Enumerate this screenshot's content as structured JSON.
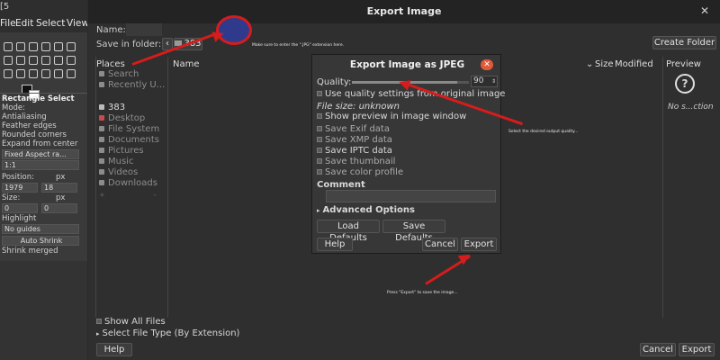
{
  "gimp": {
    "menu": [
      "File",
      "Edit",
      "Select",
      "View"
    ],
    "tool_title": "Rectangle Select",
    "mode_label": "Mode:",
    "options": [
      "Antialiasing",
      "Feather edges",
      "Rounded corners",
      "Expand from center"
    ],
    "fixed": "Fixed Aspect ra...",
    "ratio": "1:1",
    "position_label": "Position:",
    "position_unit": "px",
    "position_values": [
      "1979",
      "18"
    ],
    "size_label": "Size:",
    "size_unit": "px",
    "size_values": [
      "0",
      "0"
    ],
    "highlight": "Highlight",
    "guides": "No guides",
    "auto_shrink": "Auto Shrink",
    "shrink_merged": "Shrink merged"
  },
  "dialog": {
    "title": "Export Image",
    "name_label": "Name:",
    "save_in_label": "Save in folder:",
    "folder": "383",
    "create_folder": "Create Folder",
    "columns": {
      "places": "Places",
      "name": "Name",
      "size": "Size",
      "modified": "Modified",
      "preview": "Preview"
    },
    "places": [
      "Search",
      "Recently U...",
      "383",
      "Desktop",
      "File System",
      "Documents",
      "Pictures",
      "Music",
      "Videos",
      "Downloads"
    ],
    "preview_none": "No s...ction",
    "show_all": "Show All Files",
    "file_type": "Select File Type (By Extension)",
    "help": "Help",
    "cancel": "Cancel",
    "export": "Export"
  },
  "jpeg": {
    "title": "Export Image as JPEG",
    "quality_label": "Quality:",
    "quality_value": "90",
    "quality_fraction": 0.9,
    "use_quality": "Use quality settings from original image",
    "file_size": "File size: unknown",
    "show_preview": "Show preview in image window",
    "save_exif": "Save Exif data",
    "save_xmp": "Save XMP data",
    "save_iptc": "Save IPTC data",
    "save_thumb": "Save thumbnail",
    "save_color": "Save color profile",
    "comment": "Comment",
    "advanced": "Advanced Options",
    "load_defaults": "Load Defaults",
    "save_defaults": "Save Defaults",
    "help": "Help",
    "cancel": "Cancel",
    "export": "Export"
  },
  "notes": {
    "extension": "Make sure to enter the \".JPG\" extension here.",
    "quality": "Select the desired output quality...",
    "export": "Press \"Export\" to save the image..."
  },
  "colors": {
    "annotation_red": "#d61c1c",
    "circle_fill": "#303a8c"
  }
}
